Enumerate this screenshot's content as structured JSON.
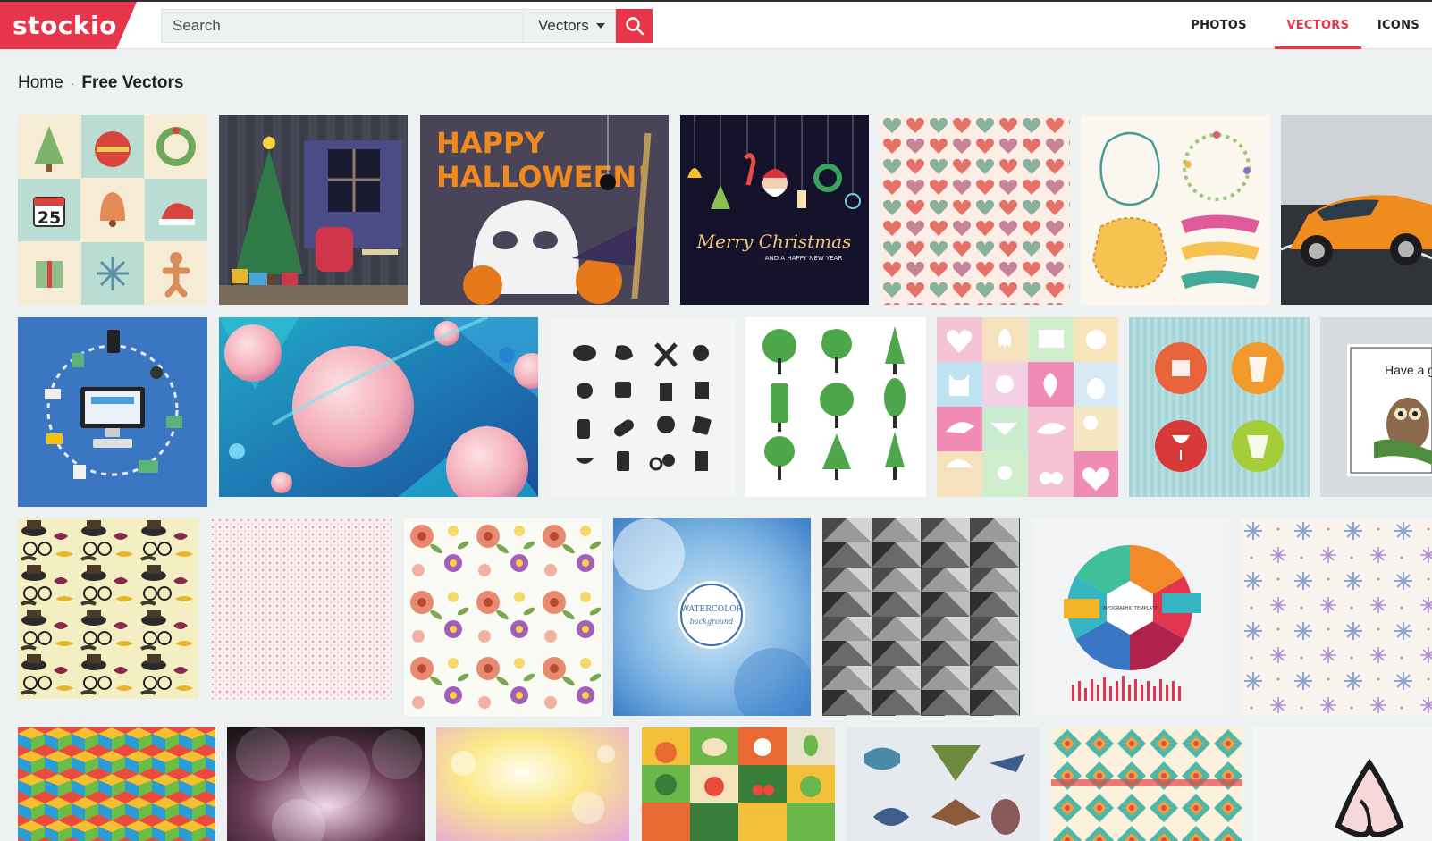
{
  "header": {
    "logo_text": "stockio",
    "search": {
      "placeholder": "Search",
      "value": ""
    },
    "type_select": {
      "selected": "Vectors"
    },
    "nav": [
      {
        "label": "PHOTOS",
        "active": false
      },
      {
        "label": "VECTORS",
        "active": true
      },
      {
        "label": "ICONS",
        "active": false
      }
    ],
    "accent_color": "#e7364b"
  },
  "breadcrumb": {
    "home": "Home",
    "separator": "·",
    "current": "Free Vectors"
  },
  "thumbnails": {
    "christmas_icons": {
      "calendar_day": "25"
    },
    "halloween": {
      "title_line1": "HAPPY",
      "title_line2": "HALLOWEEN!"
    },
    "merry_christmas": {
      "title": "Merry Christmas",
      "subtitle": "AND A HAPPY NEW YEAR"
    },
    "owl_card": {
      "text": "Have a g"
    },
    "watercolor": {
      "line1": "WATERCOLOR",
      "line2": "background"
    },
    "infographic": {
      "title": "INFOGRAPHIC TEMPLATE"
    }
  }
}
